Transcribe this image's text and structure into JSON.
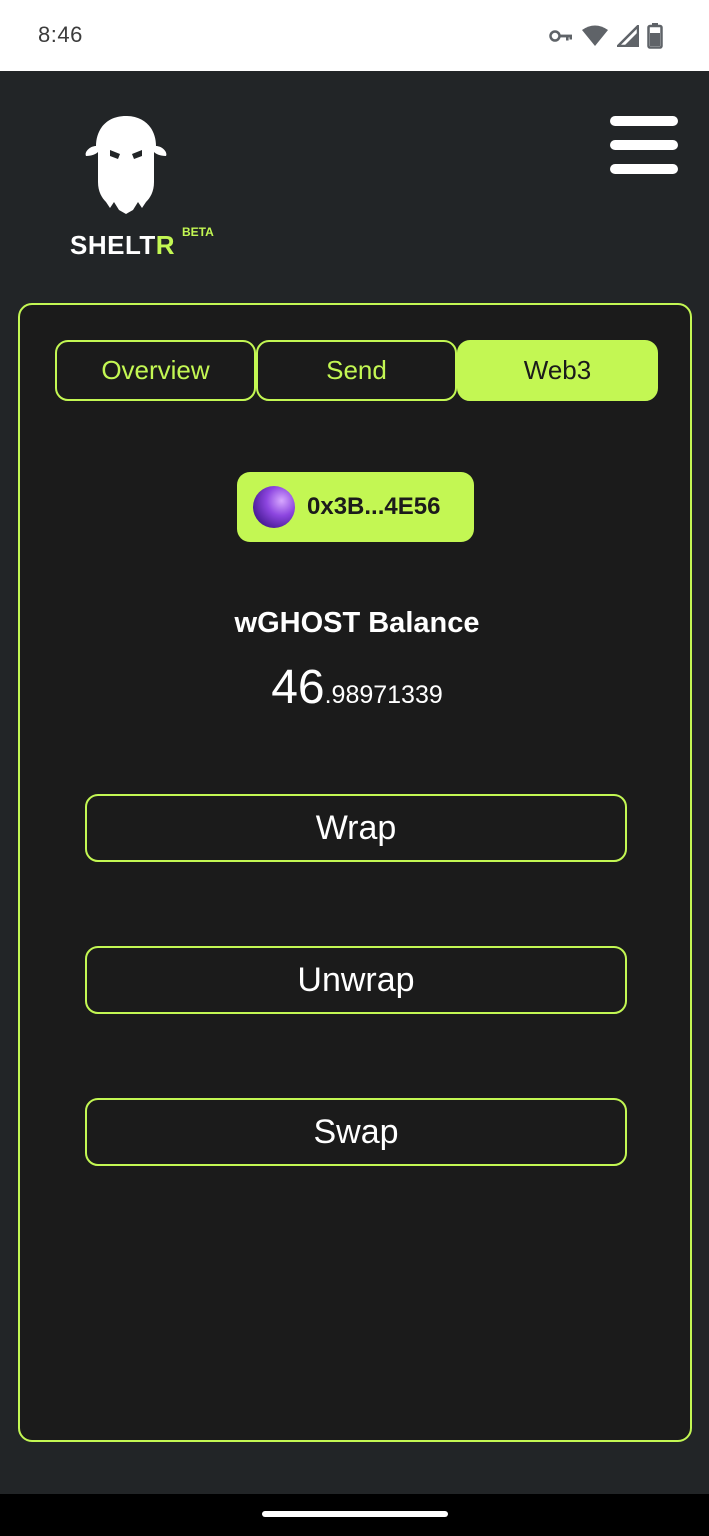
{
  "status_bar": {
    "time": "8:46",
    "icons": [
      "vpn-key-icon",
      "wifi-icon",
      "signal-icon",
      "battery-icon"
    ]
  },
  "header": {
    "brand_prefix": "SHELT",
    "brand_suffix": "R",
    "beta_label": "BETA",
    "logo_icon": "ghost-icon",
    "menu_icon": "hamburger-menu-icon"
  },
  "tabs": [
    {
      "label": "Overview",
      "active": false
    },
    {
      "label": "Send",
      "active": false
    },
    {
      "label": "Web3",
      "active": true
    }
  ],
  "wallet": {
    "address": "0x3B...4E56"
  },
  "balance": {
    "label": "wGHOST Balance",
    "integer_part": "46",
    "decimal_part": ".98971339"
  },
  "actions": {
    "wrap": "Wrap",
    "unwrap": "Unwrap",
    "swap": "Swap"
  },
  "colors": {
    "accent": "#c3f753",
    "background": "#222527",
    "card_background": "#1b1b1b"
  }
}
